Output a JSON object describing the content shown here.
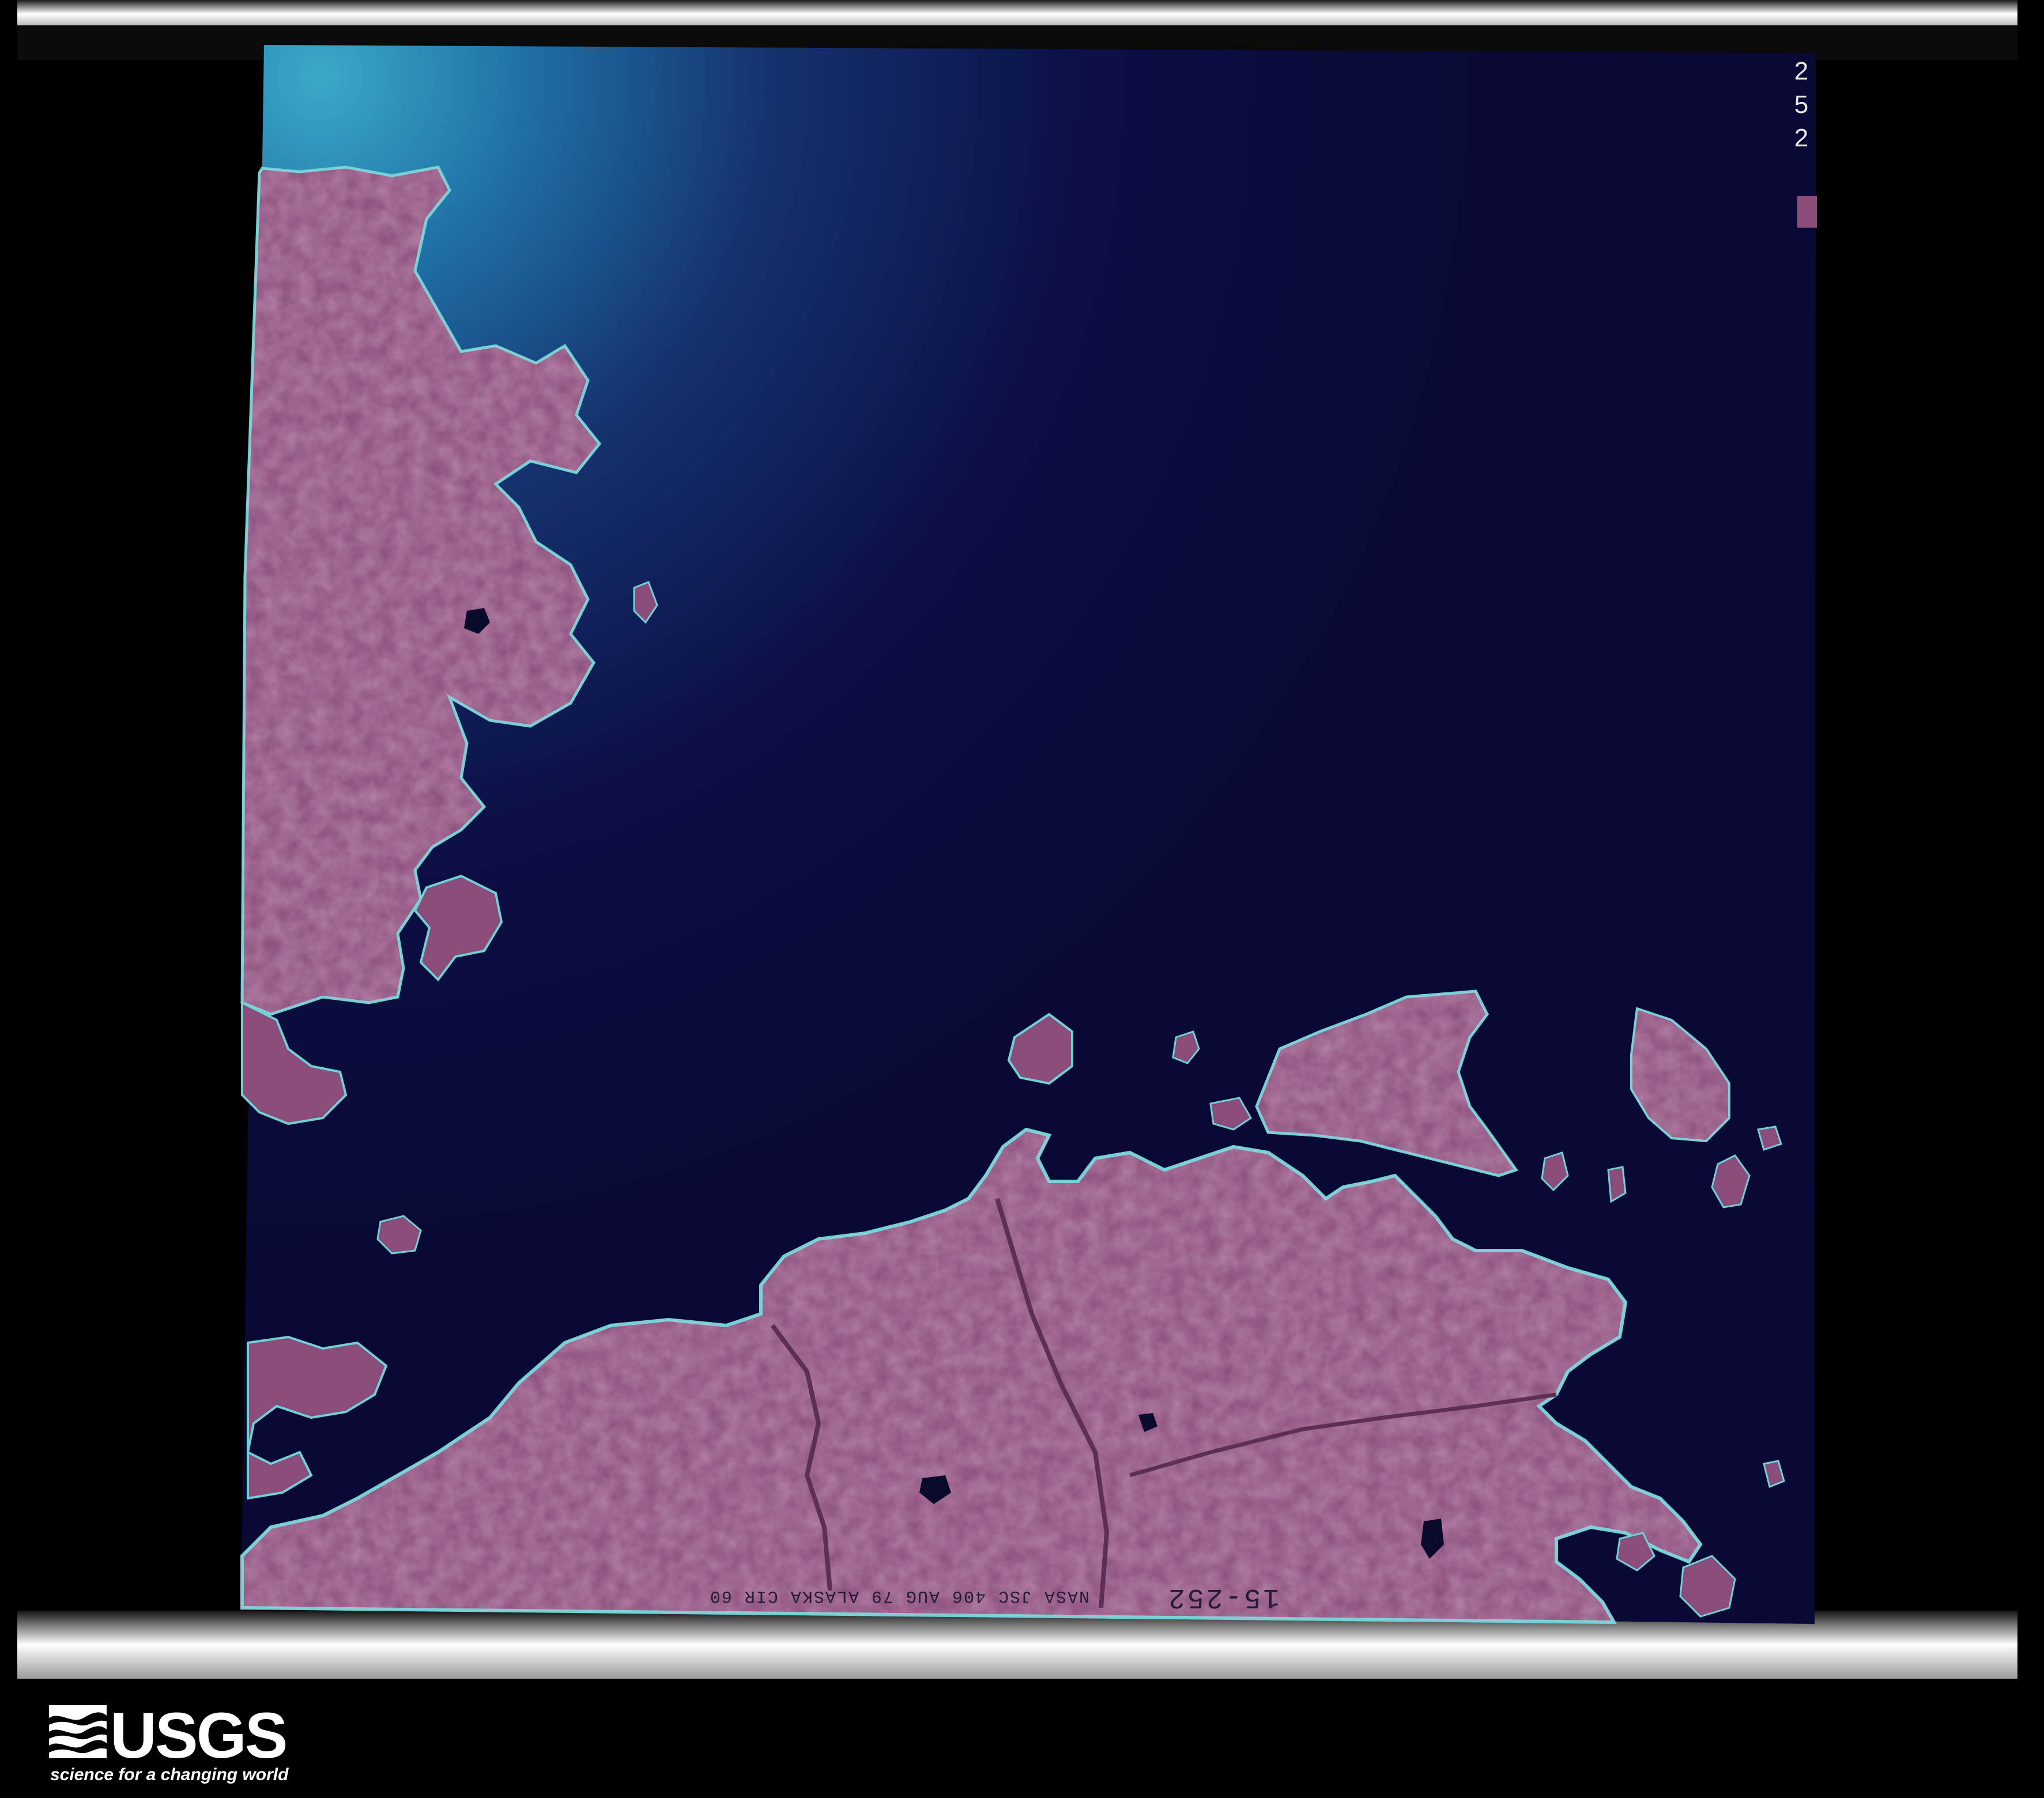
{
  "film_frame": {
    "frame_number_digits": [
      "2",
      "5",
      "2"
    ],
    "edge_code": "15-252",
    "edge_caption": "NASA  JSC  406  AUG 79   ALASKA  CIR  60"
  },
  "logo": {
    "wordmark": "USGS",
    "tagline": "science for a changing world"
  },
  "colors": {
    "background": "#000000",
    "deep_water": "#0b0a3a",
    "shallow_water": "#2a8cb4",
    "land": "#8a4c7a",
    "land_highlight": "#a86a95",
    "shoreline": "#6fd3d6",
    "film_strip": "#f2f2f2"
  },
  "icons": {
    "logo_mark": "usgs-wave-icon"
  }
}
